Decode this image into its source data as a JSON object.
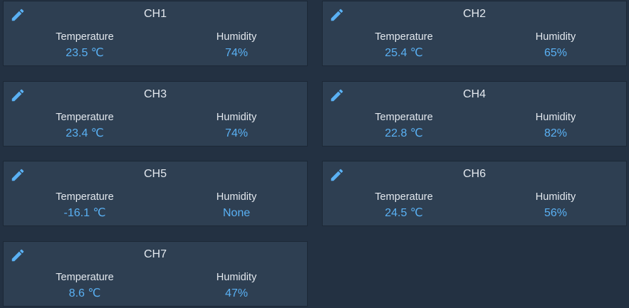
{
  "accent_color": "#5ab1f4",
  "edit_icon": "pencil-icon",
  "channels": [
    {
      "title": "CH1",
      "temp_label": "Temperature",
      "temp_value": "23.5 ℃",
      "hum_label": "Humidity",
      "hum_value": "74%"
    },
    {
      "title": "CH2",
      "temp_label": "Temperature",
      "temp_value": "25.4 ℃",
      "hum_label": "Humidity",
      "hum_value": "65%"
    },
    {
      "title": "CH3",
      "temp_label": "Temperature",
      "temp_value": "23.4 ℃",
      "hum_label": "Humidity",
      "hum_value": "74%"
    },
    {
      "title": "CH4",
      "temp_label": "Temperature",
      "temp_value": "22.8 ℃",
      "hum_label": "Humidity",
      "hum_value": "82%"
    },
    {
      "title": "CH5",
      "temp_label": "Temperature",
      "temp_value": "-16.1 ℃",
      "hum_label": "Humidity",
      "hum_value": "None"
    },
    {
      "title": "CH6",
      "temp_label": "Temperature",
      "temp_value": "24.5 ℃",
      "hum_label": "Humidity",
      "hum_value": "56%"
    },
    {
      "title": "CH7",
      "temp_label": "Temperature",
      "temp_value": "8.6 ℃",
      "hum_label": "Humidity",
      "hum_value": "47%"
    }
  ]
}
